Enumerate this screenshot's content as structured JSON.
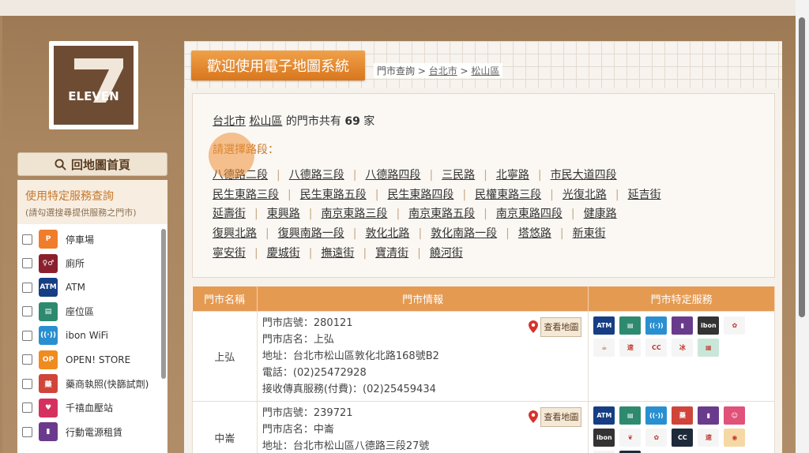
{
  "logo": {
    "text": "ELEVEN"
  },
  "sidebar": {
    "home_label": "回地圖首頁",
    "svc_title": "使用特定服務查詢",
    "svc_subtitle": "(請勾選搜尋提供服務之門市)",
    "items": [
      {
        "label": "停車場",
        "icon": "parking-icon",
        "color": "#ef7d2b",
        "glyph": "P"
      },
      {
        "label": "廁所",
        "icon": "restroom-icon",
        "color": "#8b1f2d",
        "glyph": "♀♂"
      },
      {
        "label": "ATM",
        "icon": "atm-icon",
        "color": "#163e85",
        "glyph": "ATM"
      },
      {
        "label": "座位區",
        "icon": "seating-icon",
        "color": "#2e8a6e",
        "glyph": "▤"
      },
      {
        "label": "ibon WiFi",
        "icon": "wifi-icon",
        "color": "#2a8fd1",
        "glyph": "((·))"
      },
      {
        "label": "OPEN! STORE",
        "icon": "openstore-icon",
        "color": "#f08b1e",
        "glyph": "OP"
      },
      {
        "label": "藥商執照(快篩試劑)",
        "icon": "pharmacy-icon",
        "color": "#d0443a",
        "glyph": "藥"
      },
      {
        "label": "千禧血壓站",
        "icon": "blood-pressure-icon",
        "color": "#d6315e",
        "glyph": "♥"
      },
      {
        "label": "行動電源租賃",
        "icon": "powerbank-icon",
        "color": "#6a3b8c",
        "glyph": "▮"
      }
    ]
  },
  "header": {
    "welcome": "歡迎使用電子地圖系統",
    "breadcrumb": {
      "prefix": "門市查詢 > ",
      "city": "台北市",
      "sep": " > ",
      "district": "松山區"
    }
  },
  "summary": {
    "city": "台北市",
    "district": "松山區",
    "mid": " 的門市共有 ",
    "count": "69",
    "suffix": " 家"
  },
  "road_prompt": "請選擇路段：",
  "roads": [
    [
      "八德路二段",
      "八德路三段",
      "八德路四段",
      "三民路",
      "北寧路",
      "市民大道四段"
    ],
    [
      "民生東路三段",
      "民生東路五段",
      "民生東路四段",
      "民權東路三段",
      "光復北路",
      "延吉街"
    ],
    [
      "延壽街",
      "東興路",
      "南京東路三段",
      "南京東路五段",
      "南京東路四段",
      "健康路"
    ],
    [
      "復興北路",
      "復興南路一段",
      "敦化北路",
      "敦化南路一段",
      "塔悠路",
      "新東街"
    ],
    [
      "寧安街",
      "慶城街",
      "撫遠街",
      "寶清街",
      "饒河街"
    ]
  ],
  "table": {
    "headers": [
      "門市名稱",
      "門市情報",
      "門市特定服務"
    ],
    "map_btn": "查看地圖",
    "rows": [
      {
        "name": "上弘",
        "info": [
          "門市店號：280121",
          "門市店名：上弘",
          "地址：台北市松山區敦化北路168號B2",
          "電話：(02)25472928",
          "接收傳真服務(付費)：(02)25459434"
        ],
        "services": [
          {
            "icon": "atm-icon",
            "color": "#163e85",
            "glyph": "ATM"
          },
          {
            "icon": "seating-icon",
            "color": "#2e8a6e",
            "glyph": "▤"
          },
          {
            "icon": "wifi-icon",
            "color": "#2a8fd1",
            "glyph": "((·))"
          },
          {
            "icon": "powerbank-icon",
            "color": "#6a3b8c",
            "glyph": "▮"
          },
          {
            "icon": "ibon-icon",
            "color": "#333333",
            "glyph": "ibon"
          },
          {
            "icon": "brand-icon",
            "color": "#f5f5f5",
            "glyph": "✿"
          },
          {
            "icon": "coffee-icon",
            "color": "#f5f5f5",
            "glyph": "☕"
          },
          {
            "icon": "delivery-icon",
            "color": "#f5f5f5",
            "glyph": "速"
          },
          {
            "icon": "citycafe-icon",
            "color": "#f5f5f5",
            "glyph": "CC"
          },
          {
            "icon": "ice-icon",
            "color": "#f5f5f5",
            "glyph": "冰"
          },
          {
            "icon": "bill-icon",
            "color": "#c9e7d8",
            "glyph": "▦"
          }
        ]
      },
      {
        "name": "中崙",
        "info": [
          "門市店號：239721",
          "門市店名：中崙",
          "地址：台北市松山區八德路三段27號"
        ],
        "services": [
          {
            "icon": "atm-icon",
            "color": "#163e85",
            "glyph": "ATM"
          },
          {
            "icon": "seating-icon",
            "color": "#2e8a6e",
            "glyph": "▤"
          },
          {
            "icon": "wifi-icon",
            "color": "#2a8fd1",
            "glyph": "((·))"
          },
          {
            "icon": "pharmacy-icon",
            "color": "#d0443a",
            "glyph": "藥"
          },
          {
            "icon": "powerbank-icon",
            "color": "#6a3b8c",
            "glyph": "▮"
          },
          {
            "icon": "mask-icon",
            "color": "#e0527a",
            "glyph": "☺"
          },
          {
            "icon": "ibon-icon",
            "color": "#333333",
            "glyph": "ibon"
          },
          {
            "icon": "leaf-icon",
            "color": "#f5f5f5",
            "glyph": "❦"
          },
          {
            "icon": "brand-icon",
            "color": "#f5f5f5",
            "glyph": "✿"
          },
          {
            "icon": "citycafe-dark-icon",
            "color": "#1d2a3a",
            "glyph": "CC"
          },
          {
            "icon": "delivery-icon",
            "color": "#f5f5f5",
            "glyph": "速"
          },
          {
            "icon": "cake-icon",
            "color": "#f6d8a5",
            "glyph": "◉"
          },
          {
            "icon": "citycafe-icon",
            "color": "#f5f5f5",
            "glyph": "CC"
          },
          {
            "icon": "citycafe-dark2-icon",
            "color": "#1d2a3a",
            "glyph": "CC"
          }
        ]
      }
    ]
  }
}
